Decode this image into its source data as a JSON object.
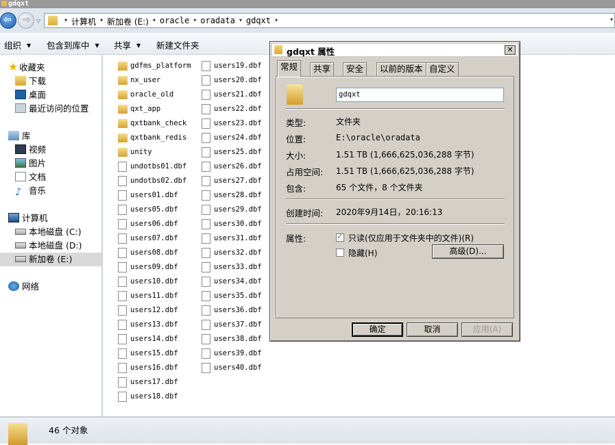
{
  "window": {
    "title": "gdqxt"
  },
  "address": {
    "crumbs": [
      "计算机",
      "新加卷 (E:)",
      "oracle",
      "oradata",
      "gdqxt"
    ]
  },
  "toolbar": {
    "organize": "组织",
    "include_in_library": "包含到库中",
    "share": "共享",
    "new_folder": "新建文件夹"
  },
  "nav": {
    "favorites": "收藏夹",
    "downloads": "下载",
    "desktop": "桌面",
    "recent": "最近访问的位置",
    "libraries": "库",
    "videos": "视频",
    "pictures": "图片",
    "documents": "文档",
    "music": "音乐",
    "computer": "计算机",
    "drive_c": "本地磁盘 (C:)",
    "drive_d": "本地磁盘 (D:)",
    "drive_e": "新加卷 (E:)",
    "network": "网络"
  },
  "files": {
    "col1": [
      {
        "name": "gdfms_platform",
        "type": "folder"
      },
      {
        "name": "nx_user",
        "type": "folder"
      },
      {
        "name": "oracle_old",
        "type": "folder"
      },
      {
        "name": "qxt_app",
        "type": "folder"
      },
      {
        "name": "qxtbank_check",
        "type": "folder"
      },
      {
        "name": "qxtbank_redis",
        "type": "folder"
      },
      {
        "name": "unity",
        "type": "folder"
      },
      {
        "name": "undotbs01.dbf",
        "type": "file"
      },
      {
        "name": "undotbs02.dbf",
        "type": "file"
      },
      {
        "name": "users01.dbf",
        "type": "file"
      },
      {
        "name": "users05.dbf",
        "type": "file"
      },
      {
        "name": "users06.dbf",
        "type": "file"
      },
      {
        "name": "users07.dbf",
        "type": "file"
      },
      {
        "name": "users08.dbf",
        "type": "file"
      },
      {
        "name": "users09.dbf",
        "type": "file"
      },
      {
        "name": "users10.dbf",
        "type": "file"
      },
      {
        "name": "users11.dbf",
        "type": "file"
      },
      {
        "name": "users12.dbf",
        "type": "file"
      },
      {
        "name": "users13.dbf",
        "type": "file"
      },
      {
        "name": "users14.dbf",
        "type": "file"
      },
      {
        "name": "users15.dbf",
        "type": "file"
      },
      {
        "name": "users16.dbf",
        "type": "file"
      },
      {
        "name": "users17.dbf",
        "type": "file"
      },
      {
        "name": "users18.dbf",
        "type": "file"
      }
    ],
    "col2": [
      {
        "name": "users19.dbf",
        "type": "file"
      },
      {
        "name": "users20.dbf",
        "type": "file"
      },
      {
        "name": "users21.dbf",
        "type": "file"
      },
      {
        "name": "users22.dbf",
        "type": "file"
      },
      {
        "name": "users23.dbf",
        "type": "file"
      },
      {
        "name": "users24.dbf",
        "type": "file"
      },
      {
        "name": "users25.dbf",
        "type": "file"
      },
      {
        "name": "users26.dbf",
        "type": "file"
      },
      {
        "name": "users27.dbf",
        "type": "file"
      },
      {
        "name": "users28.dbf",
        "type": "file"
      },
      {
        "name": "users29.dbf",
        "type": "file"
      },
      {
        "name": "users30.dbf",
        "type": "file"
      },
      {
        "name": "users31.dbf",
        "type": "file"
      },
      {
        "name": "users32.dbf",
        "type": "file"
      },
      {
        "name": "users33.dbf",
        "type": "file"
      },
      {
        "name": "users34.dbf",
        "type": "file"
      },
      {
        "name": "users35.dbf",
        "type": "file"
      },
      {
        "name": "users36.dbf",
        "type": "file"
      },
      {
        "name": "users37.dbf",
        "type": "file"
      },
      {
        "name": "users38.dbf",
        "type": "file"
      },
      {
        "name": "users39.dbf",
        "type": "file"
      },
      {
        "name": "users40.dbf",
        "type": "file"
      }
    ]
  },
  "status": {
    "count_text": "46 个对象"
  },
  "dialog": {
    "title": "gdqxt 属性",
    "close": "✕",
    "tabs": [
      "常规",
      "共享",
      "安全",
      "以前的版本",
      "自定义"
    ],
    "name_value": "gdqxt",
    "rows": {
      "type_label": "类型:",
      "type_value": "文件夹",
      "location_label": "位置:",
      "location_value": "E:\\oracle\\oradata",
      "size_label": "大小:",
      "size_value": "1.51 TB (1,666,625,036,288 字节)",
      "disk_label": "占用空间:",
      "disk_value": "1.51 TB (1,666,625,036,288 字节)",
      "contains_label": "包含:",
      "contains_value": "65 个文件，8 个文件夹",
      "created_label": "创建时间:",
      "created_value": "2020年9月14日，20:16:13",
      "attrs_label": "属性:"
    },
    "readonly_label": "只读(仅应用于文件夹中的文件)(R)",
    "readonly_checked": true,
    "hidden_label": "隐藏(H)",
    "hidden_checked": false,
    "advanced_button": "高级(D)...",
    "ok_button": "确定",
    "cancel_button": "取消",
    "apply_button": "应用(A)"
  }
}
